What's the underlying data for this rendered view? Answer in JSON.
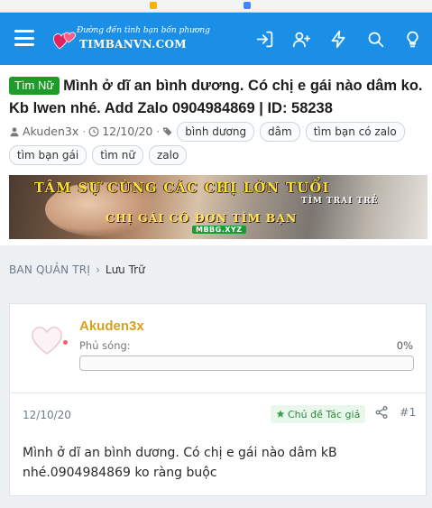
{
  "header": {
    "logo_tagline": "Đường đến tình bạn bốn phương",
    "logo_brand": "TIMBANVN.COM",
    "icons": [
      "menu-icon",
      "login-icon",
      "register-icon",
      "whats-new-icon",
      "search-icon",
      "light-bulb-icon"
    ],
    "accent": "#1b8fe6"
  },
  "thread": {
    "prefix": "Tìm Nữ",
    "prefix_color": "#1e9b2a",
    "title": "Mình ở dĩ an bình dương. Có chị e gái nào dâm ko. Kb lwen nhé. Add Zalo 0904984869 | ID: 58238",
    "author": "Akuden3x",
    "date": "12/10/20",
    "tags": [
      "bình dương",
      "dâm",
      "tìm bạn có zalo",
      "tìm bạn gái",
      "tìm nữ",
      "zalo"
    ]
  },
  "banner": {
    "line1": "TÂM SỰ CÙNG CÁC CHỊ LỚN TUỔI",
    "line2": "TÌM TRAI TRẺ",
    "line3": "CHỊ GÁI CÔ ĐƠN TÌM BẠN",
    "line4": "MBBG.XYZ"
  },
  "breadcrumb": {
    "items": [
      "BAN QUẢN TRỊ",
      "Lưu Trữ"
    ]
  },
  "post": {
    "username": "Akuden3x",
    "coverage_label": "Phủ sóng:",
    "coverage_value": "0%",
    "coverage_fraction": 0,
    "date": "12/10/20",
    "author_badge": "Chủ đề Tác giả",
    "number": "#1",
    "body": "Mình ở dĩ an bình dương. Có chị e gái nào dâm kB nhé.0904984869 ko ràng buộc"
  }
}
